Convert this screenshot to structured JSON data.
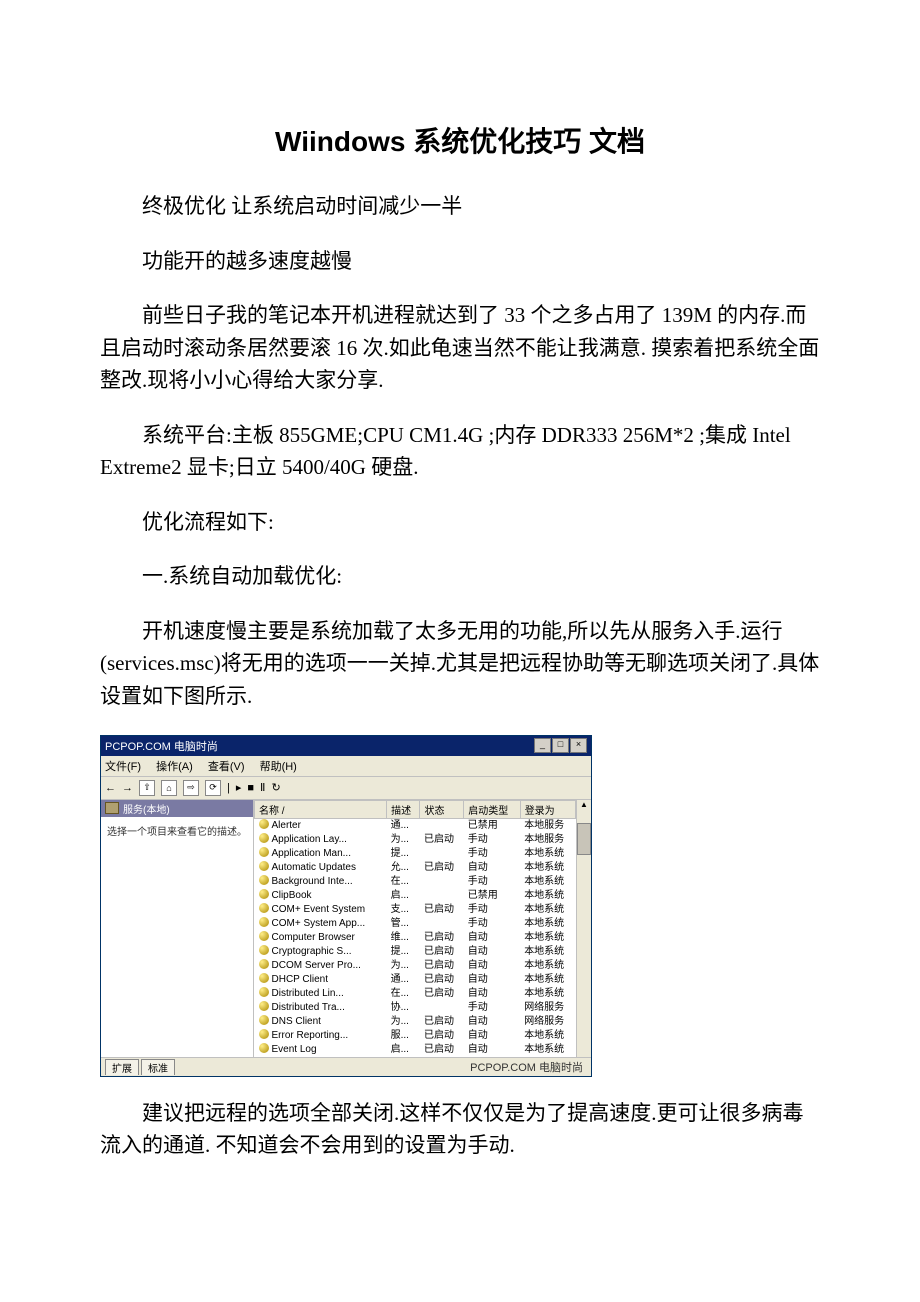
{
  "doc": {
    "title": "Wiindows 系统优化技巧 文档",
    "p1": "终极优化 让系统启动时间减少一半",
    "p2": "功能开的越多速度越慢",
    "p3": "前些日子我的笔记本开机进程就达到了 33 个之多占用了 139M 的内存.而且启动时滚动条居然要滚 16 次.如此龟速当然不能让我满意. 摸索着把系统全面整改.现将小小心得给大家分享.",
    "p4": "系统平台:主板 855GME;CPU CM1.4G ;内存 DDR333 256M*2 ;集成 Intel Extreme2 显卡;日立 5400/40G 硬盘.",
    "p5": "优化流程如下:",
    "p6": "一.系统自动加载优化:",
    "p7": "开机速度慢主要是系统加载了太多无用的功能,所以先从服务入手.运行(services.msc)将无用的选项一一关掉.尤其是把远程协助等无聊选项关闭了.具体设置如下图所示.",
    "p8": "建议把远程的选项全部关闭.这样不仅仅是为了提高速度.更可让很多病毒流入的通道. 不知道会不会用到的设置为手动."
  },
  "win": {
    "title": "PCPOP.COM 电脑时尚",
    "min": "_",
    "max": "□",
    "close": "×",
    "menu": {
      "file": "文件(F)",
      "action": "操作(A)",
      "view": "查看(V)",
      "help": "帮助(H)"
    },
    "tree": "服务(本地)",
    "leftHint": "选择一个项目来查看它的描述。",
    "cols": {
      "name": "名称  /",
      "desc": "描述",
      "status": "状态",
      "startup": "启动类型",
      "logon": "登录为"
    },
    "rows": [
      {
        "name": "Alerter",
        "desc": "通...",
        "status": "",
        "startup": "已禁用",
        "logon": "本地服务"
      },
      {
        "name": "Application Lay...",
        "desc": "为...",
        "status": "已启动",
        "startup": "手动",
        "logon": "本地服务"
      },
      {
        "name": "Application Man...",
        "desc": "提...",
        "status": "",
        "startup": "手动",
        "logon": "本地系统"
      },
      {
        "name": "Automatic Updates",
        "desc": "允...",
        "status": "已启动",
        "startup": "自动",
        "logon": "本地系统"
      },
      {
        "name": "Background Inte...",
        "desc": "在...",
        "status": "",
        "startup": "手动",
        "logon": "本地系统"
      },
      {
        "name": "ClipBook",
        "desc": "启...",
        "status": "",
        "startup": "已禁用",
        "logon": "本地系统"
      },
      {
        "name": "COM+ Event System",
        "desc": "支...",
        "status": "已启动",
        "startup": "手动",
        "logon": "本地系统"
      },
      {
        "name": "COM+ System App...",
        "desc": "管...",
        "status": "",
        "startup": "手动",
        "logon": "本地系统"
      },
      {
        "name": "Computer Browser",
        "desc": "维...",
        "status": "已启动",
        "startup": "自动",
        "logon": "本地系统"
      },
      {
        "name": "Cryptographic S...",
        "desc": "提...",
        "status": "已启动",
        "startup": "自动",
        "logon": "本地系统"
      },
      {
        "name": "DCOM Server Pro...",
        "desc": "为...",
        "status": "已启动",
        "startup": "自动",
        "logon": "本地系统"
      },
      {
        "name": "DHCP Client",
        "desc": "通...",
        "status": "已启动",
        "startup": "自动",
        "logon": "本地系统"
      },
      {
        "name": "Distributed Lin...",
        "desc": "在...",
        "status": "已启动",
        "startup": "自动",
        "logon": "本地系统"
      },
      {
        "name": "Distributed Tra...",
        "desc": "协...",
        "status": "",
        "startup": "手动",
        "logon": "网络服务"
      },
      {
        "name": "DNS Client",
        "desc": "为...",
        "status": "已启动",
        "startup": "自动",
        "logon": "网络服务"
      },
      {
        "name": "Error Reporting...",
        "desc": "服...",
        "status": "已启动",
        "startup": "自动",
        "logon": "本地系统"
      },
      {
        "name": "Event Log",
        "desc": "启...",
        "status": "已启动",
        "startup": "自动",
        "logon": "本地系统"
      }
    ],
    "tabExt": "扩展",
    "tabStd": "标准",
    "footer": "PCPOP.COM 电脑时尚"
  }
}
